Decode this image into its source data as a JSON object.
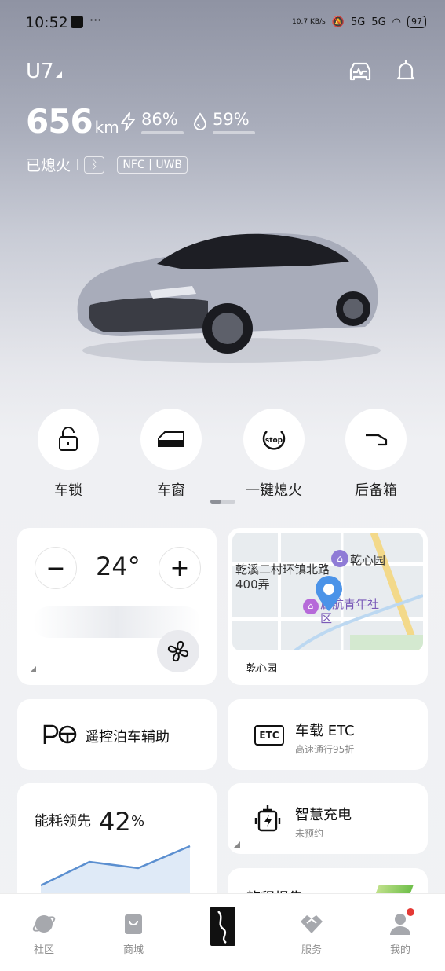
{
  "status_bar": {
    "time": "10:52",
    "net_speed": "10.7 KB/s",
    "network_1": "5G",
    "network_2": "5G",
    "battery": "97"
  },
  "vehicle": {
    "model": "U7",
    "range_value": "656",
    "range_unit": "km",
    "charge_percent": "86%",
    "charge_level": 0.86,
    "fuel_percent": "59%",
    "fuel_level": 0.59,
    "power_state": "已熄火",
    "key_chip": "NFC | UWB"
  },
  "quick_controls": [
    {
      "label": "车锁",
      "icon": "lock-icon"
    },
    {
      "label": "车窗",
      "icon": "car-window-icon"
    },
    {
      "label": "一键熄火",
      "icon": "stop-icon"
    },
    {
      "label": "后备箱",
      "icon": "trunk-icon"
    }
  ],
  "climate": {
    "temperature": "24°",
    "minus_label": "−",
    "plus_label": "+"
  },
  "map_card": {
    "poi_1": "乾心园",
    "road_label": "乾溪二村环镇北路400弄",
    "poi_2": "启航青年社区",
    "location_label": "乾心园"
  },
  "parking_assist": {
    "title": "遥控泊车辅助"
  },
  "etc": {
    "title": "车载 ETC",
    "subtitle": "高速通行95折"
  },
  "energy": {
    "label": "能耗领先",
    "value": "42",
    "unit": "%"
  },
  "smart_charge": {
    "title": "智慧充电",
    "subtitle": "未预约"
  },
  "trip_report": {
    "title": "旅程报告"
  },
  "tabs": [
    {
      "label": "社区",
      "icon": "planet-icon"
    },
    {
      "label": "商城",
      "icon": "shopping-bag-icon"
    },
    {
      "label": "",
      "icon": "brand-logo-icon"
    },
    {
      "label": "服务",
      "icon": "handshake-icon"
    },
    {
      "label": "我的",
      "icon": "profile-icon"
    }
  ],
  "colors": {
    "charge_bar": "#3cc05a",
    "fuel_bar": "#4fb0f0",
    "map_pin": "#4b93e8",
    "notification_dot": "#e53935"
  }
}
